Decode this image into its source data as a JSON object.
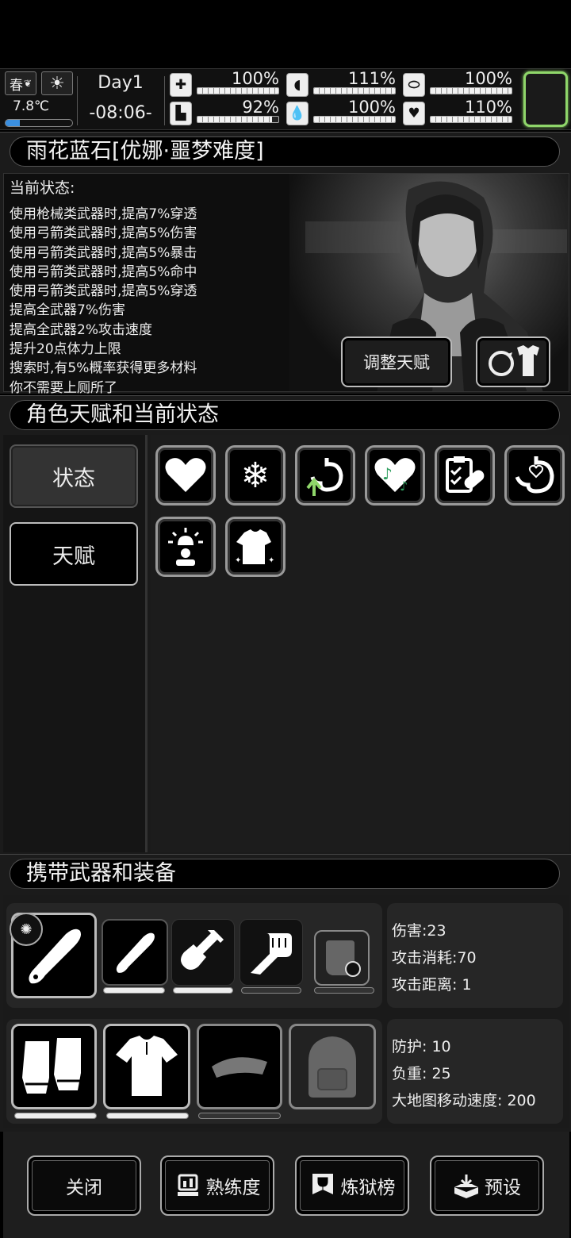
{
  "topbar": {
    "season": "春",
    "weather_icon": "sun-icon",
    "temperature": "7.8℃",
    "temperature_level": 0.22,
    "day": "Day1",
    "clock": "-08:06-",
    "stats": [
      {
        "icon": "medkit-icon",
        "value": "100%",
        "level": 1.0
      },
      {
        "icon": "stomach-icon",
        "value": "111%",
        "level": 1.0
      },
      {
        "icon": "pill-icon",
        "value": "100%",
        "level": 1.0
      },
      {
        "icon": "boot-icon",
        "value": "92%",
        "level": 0.92
      },
      {
        "icon": "water-drop-icon",
        "value": "100%",
        "level": 1.0
      },
      {
        "icon": "heart-icon",
        "value": "110%",
        "level": 1.0
      }
    ],
    "accent_color": "#8fd66a"
  },
  "character": {
    "header": "雨花蓝石[优娜·噩梦难度]",
    "status_title": "当前状态:",
    "status_lines": [
      "使用枪械类武器时,提高7%穿透",
      "使用弓箭类武器时,提高5%伤害",
      "使用弓箭类武器时,提高5%暴击",
      "使用弓箭类武器时,提高5%命中",
      "使用弓箭类武器时,提高5%穿透",
      "提高全武器7%伤害",
      "提高全武器2%攻击速度",
      "提升20点体力上限",
      "搜索时,有5%概率获得更多材料",
      "你不需要上厕所了"
    ],
    "adjust_talent_label": "调整天赋",
    "outfit_icon": "change-outfit-icon"
  },
  "talents": {
    "header": "角色天赋和当前状态",
    "tabs": [
      {
        "label": "状态",
        "active": true
      },
      {
        "label": "天赋",
        "active": false
      }
    ],
    "icons": [
      "heart-icon",
      "snowflake-icon",
      "stomach-growth-icon",
      "music-heart-icon",
      "clipboard-bandage-icon",
      "heart-stomach-icon",
      "alarm-person-icon",
      "shirt-sparkle-icon"
    ]
  },
  "equipment": {
    "header": "携带武器和装备",
    "weapons": [
      {
        "icon": "knife-icon",
        "durability": 1.0
      },
      {
        "icon": "knife-small-icon",
        "durability": 1.0
      },
      {
        "icon": "shovel-icon",
        "durability": 1.0
      },
      {
        "icon": "fist-icon",
        "durability": 0.0
      },
      {
        "icon": "riot-shield-icon",
        "durability": 0.0
      }
    ],
    "weapon_stats": [
      "伤害:23",
      "攻击消耗:70",
      "攻击距离: 1"
    ],
    "gear": [
      {
        "icon": "gloves-icon",
        "durability": 1.0
      },
      {
        "icon": "shirt-icon",
        "durability": 1.0
      },
      {
        "icon": "cap-icon",
        "durability": 0.0
      },
      {
        "icon": "backpack-icon",
        "durability": 0.0
      }
    ],
    "gear_stats": [
      "防护: 10",
      "负重: 25",
      "大地图移动速度: 200"
    ]
  },
  "bottom": {
    "close_label": "关闭",
    "proficiency_label": "熟练度",
    "ranking_label": "炼狱榜",
    "preset_label": "预设"
  }
}
